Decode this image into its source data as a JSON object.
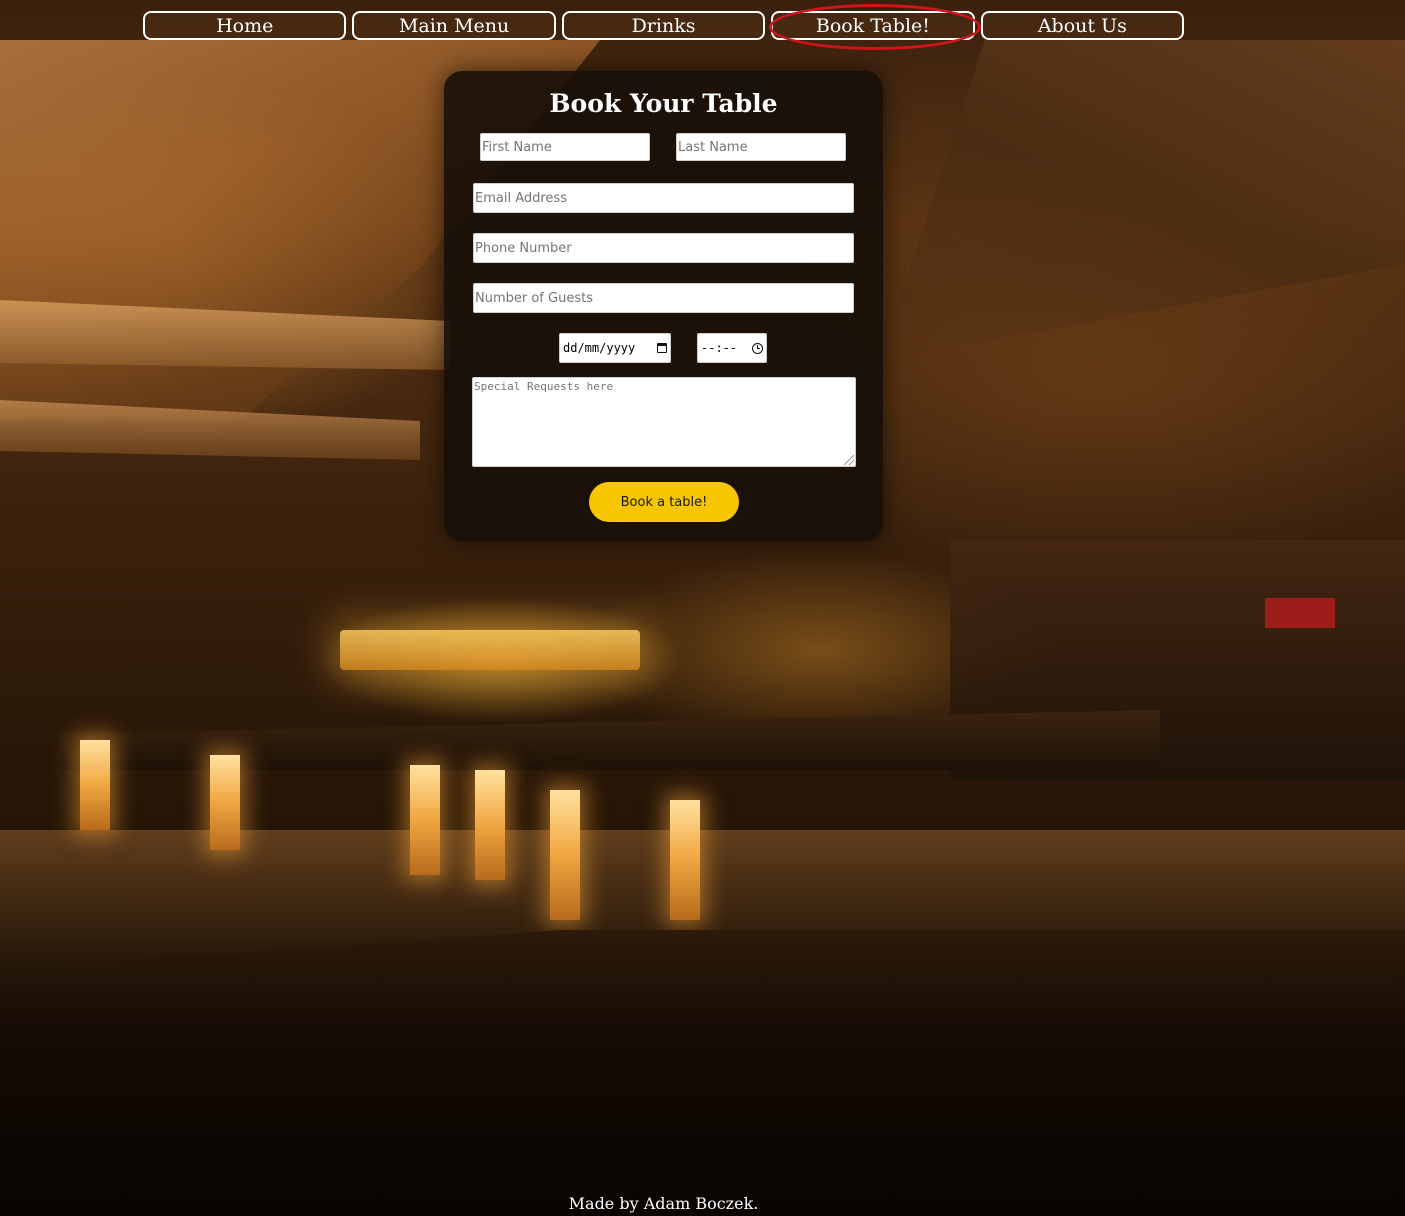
{
  "nav": {
    "items": [
      {
        "label": "Home"
      },
      {
        "label": "Main Menu"
      },
      {
        "label": "Drinks"
      },
      {
        "label": "Book Table!"
      },
      {
        "label": "About Us"
      }
    ],
    "highlighted": "Book Table!",
    "highlight_color": "#d4141c"
  },
  "booking": {
    "title": "Book Your Table",
    "first_name_placeholder": "First Name",
    "last_name_placeholder": "Last Name",
    "email_placeholder": "Email Address",
    "phone_placeholder": "Phone Number",
    "guests_placeholder": "Number of Guests",
    "date_value": "dd/mm/yyyy",
    "time_value": "--:--",
    "requests_placeholder": "Special Requests here",
    "submit_label": "Book a table!",
    "submit_color": "#f7c600"
  },
  "footer": {
    "text": "Made by Adam Boczek."
  }
}
